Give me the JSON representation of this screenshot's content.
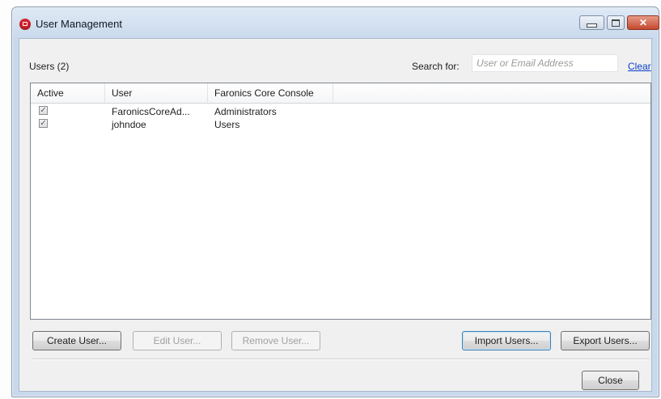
{
  "window": {
    "title": "User Management",
    "controls": {
      "minimize": "minimize",
      "maximize": "maximize",
      "close": "✕"
    }
  },
  "toolbar": {
    "users_count": "Users (2)",
    "search_label": "Search for:",
    "search_placeholder": "User or Email Address",
    "search_value": "",
    "clear_label": "Clear"
  },
  "list": {
    "columns": [
      "Active",
      "User",
      "Faronics Core Console"
    ],
    "rows": [
      {
        "active": true,
        "user": "FaronicsCoreAd...",
        "group": "Administrators"
      },
      {
        "active": true,
        "user": "johndoe",
        "group": "Users"
      }
    ]
  },
  "buttons": {
    "create": "Create User...",
    "edit": "Edit User...",
    "remove": "Remove User...",
    "import": "Import Users...",
    "export": "Export Users...",
    "close": "Close"
  },
  "icons": {
    "app": "faronics-app-icon",
    "checked": "✓"
  }
}
